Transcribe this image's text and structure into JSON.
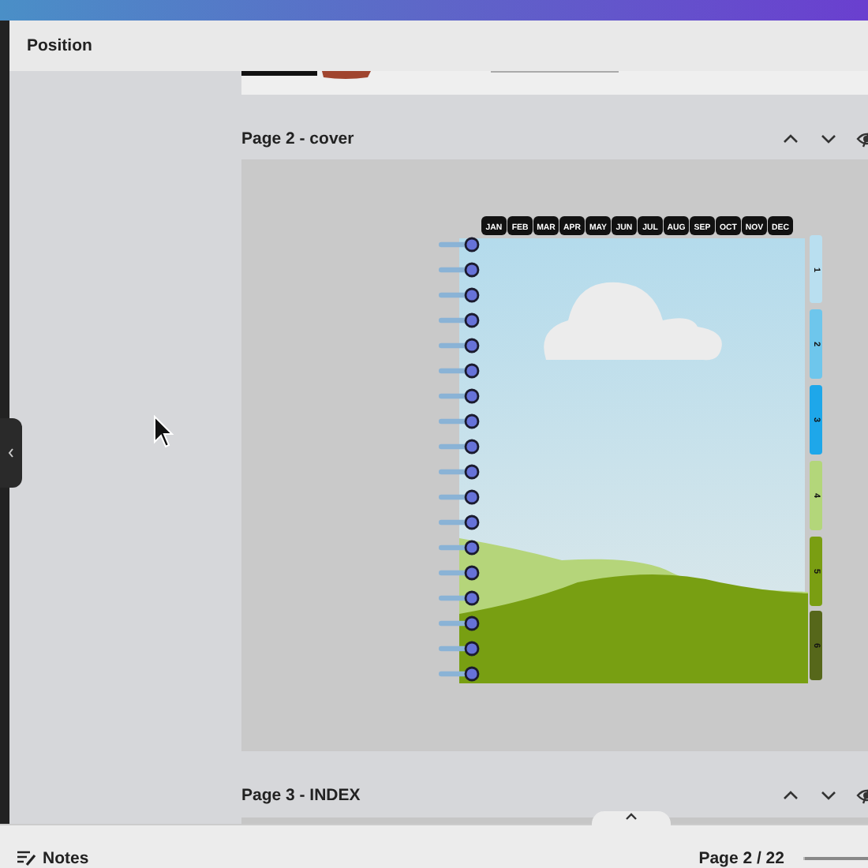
{
  "panel": {
    "title": "Position"
  },
  "pages": [
    {
      "title": "Page 2 - cover",
      "kind": "cover"
    },
    {
      "title": "Page 3 - INDEX",
      "kind": "blank"
    }
  ],
  "planner": {
    "months": [
      "JAN",
      "FEB",
      "MAR",
      "APR",
      "MAY",
      "JUN",
      "JUL",
      "AUG",
      "SEP",
      "OCT",
      "NOV",
      "DEC"
    ],
    "tabs": [
      {
        "label": "1",
        "color": "#b9dff0"
      },
      {
        "label": "2",
        "color": "#6ec6ec"
      },
      {
        "label": "3",
        "color": "#1ea7ea"
      },
      {
        "label": "4",
        "color": "#b3d67a"
      },
      {
        "label": "5",
        "color": "#7a9e12"
      },
      {
        "label": "6",
        "color": "#56671a"
      }
    ]
  },
  "footer": {
    "notes": "Notes",
    "page_indicator": "Page 2 / 22"
  }
}
